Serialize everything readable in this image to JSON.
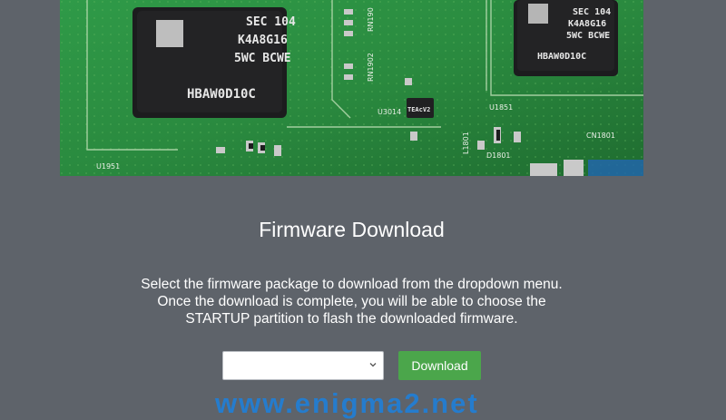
{
  "hero": {
    "image_description": "photo of a green circuit board with memory chips",
    "chip_left": {
      "lines": [
        "SEC 104",
        "K4A8G16",
        "5WC BCWE"
      ],
      "bottom": "HBAW0D10C"
    },
    "chip_right": {
      "lines": [
        "SEC 104",
        "K4A8G16",
        "5WC BCWE"
      ],
      "bottom": "HBAW0D10C"
    },
    "small_chip": "TEAcV2",
    "silkscreen": [
      "U1951",
      "RN1902",
      "RN190",
      "U3014",
      "U1851",
      "L1801",
      "D1801",
      "CN1801"
    ]
  },
  "page": {
    "title": "Firmware Download",
    "description": "Select the firmware package to download from the dropdown menu. Once the download is complete, you will be able to choose the STARTUP partition to flash the downloaded firmware."
  },
  "controls": {
    "select_value": "",
    "download_label": "Download"
  },
  "watermark": {
    "text": "www.enigma2.net"
  },
  "colors": {
    "background": "#5e636a",
    "button": "#4ba64b",
    "watermark": "#1f7fd8",
    "pcb": "#2f8a3e"
  }
}
